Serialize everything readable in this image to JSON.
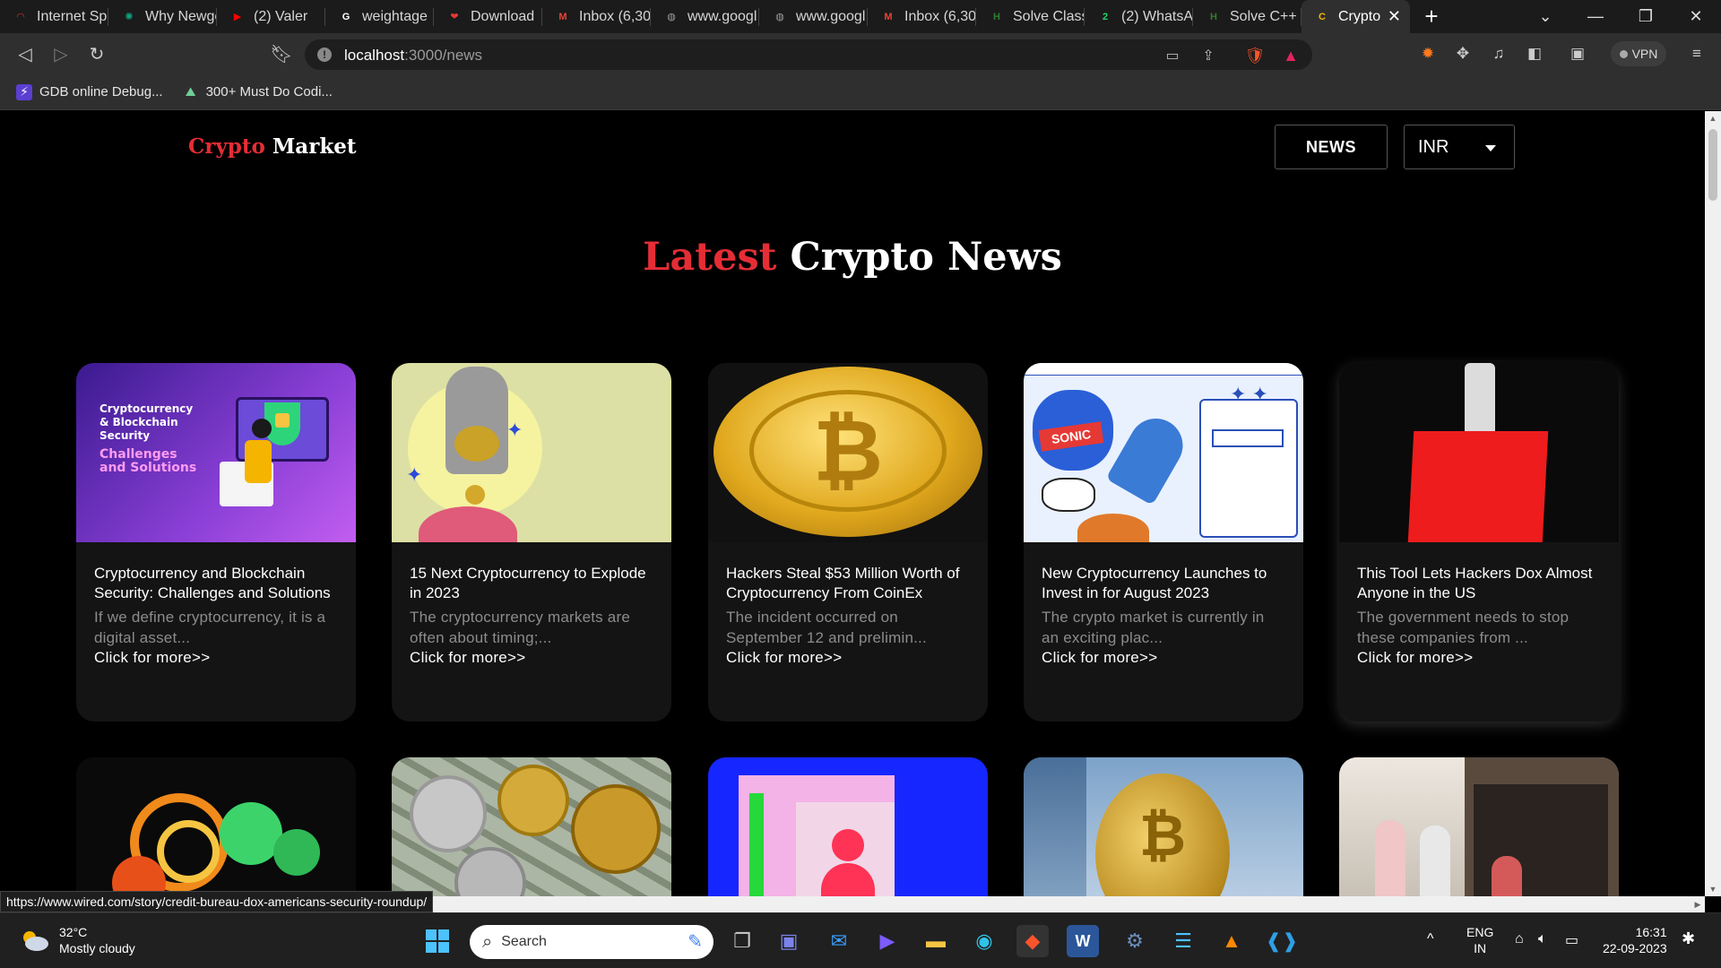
{
  "browser": {
    "tabs": [
      {
        "title": "Internet Sp",
        "color": "#d32f2f",
        "glyph": "◠"
      },
      {
        "title": "Why Newge",
        "color": "#10a37f",
        "glyph": "✺"
      },
      {
        "title": "(2) Valer",
        "color": "#ff0000",
        "glyph": "▶"
      },
      {
        "title": "weightage",
        "color": "#ffffff",
        "glyph": "G"
      },
      {
        "title": "Download",
        "color": "#e53935",
        "glyph": "❤"
      },
      {
        "title": "Inbox (6,30",
        "color": "#ea4335",
        "glyph": "M"
      },
      {
        "title": "www.googl",
        "color": "#9e9e9e",
        "glyph": "◍"
      },
      {
        "title": "www.googl",
        "color": "#9e9e9e",
        "glyph": "◍"
      },
      {
        "title": "Inbox (6,30",
        "color": "#ea4335",
        "glyph": "M"
      },
      {
        "title": "Solve Class",
        "color": "#2e7d32",
        "glyph": "H"
      },
      {
        "title": "(2) WhatsA",
        "color": "#25d366",
        "glyph": "2"
      },
      {
        "title": "Solve C++",
        "color": "#2e7d32",
        "glyph": "H"
      },
      {
        "title": "Crypto",
        "color": "#f5b400",
        "glyph": "C",
        "active": true
      }
    ],
    "address": {
      "host": "localhost",
      "path": ":3000/news"
    },
    "bookmarks": [
      {
        "label": "GDB online Debug...",
        "icon": "⚡"
      },
      {
        "label": "300+ Must Do Codi...",
        "icon": "⛰"
      }
    ],
    "vpn_label": "VPN",
    "status_url": "https://www.wired.com/story/credit-bureau-dox-americans-security-roundup/"
  },
  "nav": {
    "logo_red": "Crypto",
    "logo_white": " Market",
    "news_label": "NEWS",
    "currency": "INR"
  },
  "heading": {
    "red": "Latest",
    "white": " Crypto News"
  },
  "more_label": "Click for more>>",
  "cards": [
    {
      "title": "Cryptocurrency and Blockchain Security: Challenges and Solutions",
      "desc": "If we define cryptocurrency, it is a digital asset...",
      "image": "security-illustration",
      "image_text": [
        "Cryptocurrency",
        "& Blockchain",
        "Security",
        "Challenges",
        "and Solutions"
      ]
    },
    {
      "title": "15 Next Cryptocurrency to Explode in 2023",
      "desc": "The cryptocurrency markets are often about timing;...",
      "image": "hands-coins"
    },
    {
      "title": "Hackers Steal $53 Million Worth of Cryptocurrency From CoinEx",
      "desc": "The incident occurred on September 12 and prelimin...",
      "image": "bitcoin-coin"
    },
    {
      "title": "New Cryptocurrency Launches to Invest in for August 2023",
      "desc": "The crypto market is currently in an exciting plac...",
      "image": "comic-site"
    },
    {
      "title": "This Tool Lets Hackers Dox Almost Anyone in the US",
      "desc": "The government needs to stop these companies from ...",
      "image": "red-folder"
    },
    {
      "image": "spiral-coins"
    },
    {
      "image": "dollars-bitcoins"
    },
    {
      "image": "folder-person"
    },
    {
      "image": "gold-bitcoin"
    },
    {
      "image": "street-shoppers"
    }
  ],
  "taskbar": {
    "temperature": "32°C",
    "weather": "Mostly cloudy",
    "search_label": "Search",
    "language": "ENG",
    "region": "IN",
    "time": "16:31",
    "date": "22-09-2023"
  }
}
